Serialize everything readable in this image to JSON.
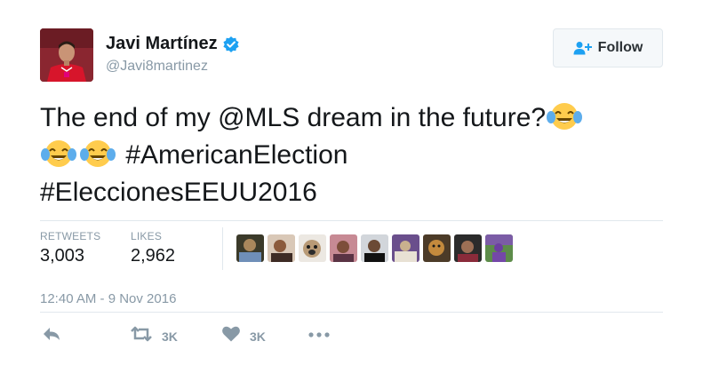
{
  "tweet": {
    "author_name": "Javi Martínez",
    "author_handle": "@Javi8martinez",
    "verified": true,
    "text_line1": "The end of my @MLS dream in the future?",
    "text_line2": "#AmericanElection",
    "text_line3": "#EleccionesEEUU2016",
    "timestamp": "12:40 AM - 9 Nov 2016"
  },
  "follow_button": {
    "label": "Follow"
  },
  "stats": {
    "retweets_label": "RETWEETS",
    "retweets_value": "3,003",
    "likes_label": "LIKES",
    "likes_value": "2,962"
  },
  "actions": {
    "retweet_count": "3K",
    "like_count": "3K"
  },
  "colors": {
    "text": "#14171a",
    "secondary": "#8899a6",
    "brand_blue": "#1da1f2",
    "divider": "#e1e8ed"
  }
}
